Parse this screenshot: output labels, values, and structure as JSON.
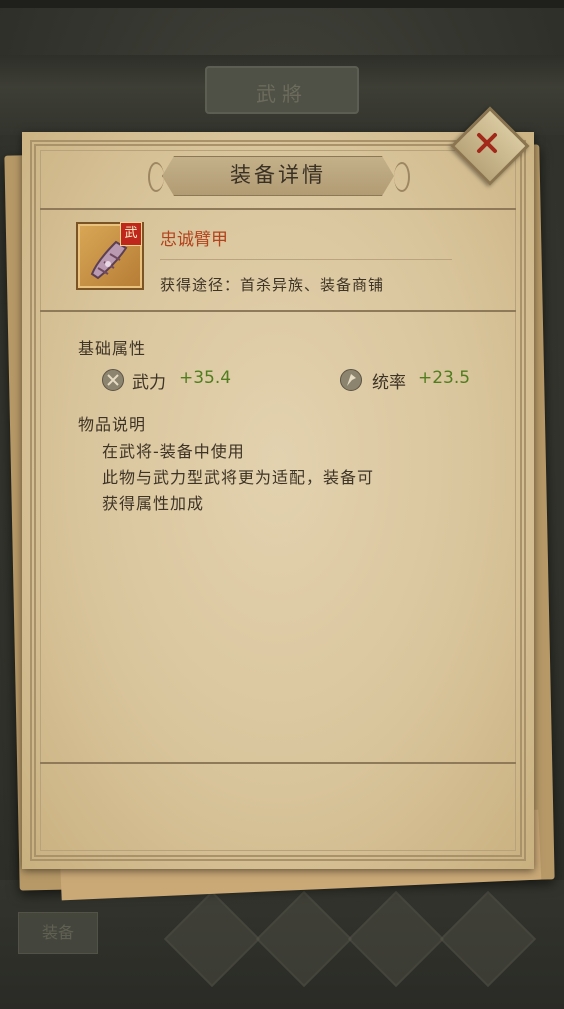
{
  "background": {
    "plaque_text": "武將",
    "tab_text": "装备"
  },
  "dialog": {
    "title": "装备详情",
    "close_icon": "close-x-icon"
  },
  "item": {
    "name": "忠诚臂甲",
    "badge": "武",
    "source": "获得途径：首杀异族、装备商铺"
  },
  "attributes": {
    "header": "基础属性",
    "stats": [
      {
        "icon": "crossed-swords-icon",
        "label": "武力",
        "value": "+35.4"
      },
      {
        "icon": "banner-icon",
        "label": "统率",
        "value": "+23.5"
      }
    ]
  },
  "description": {
    "header": "物品说明",
    "lines": [
      "在武将-装备中使用",
      "此物与武力型武将更为适配，装备可",
      "获得属性加成"
    ]
  },
  "colors": {
    "parchment": "#d9c59c",
    "item_name": "#b2431c",
    "stat_value": "#4f7d1f",
    "text": "#3e3426"
  }
}
